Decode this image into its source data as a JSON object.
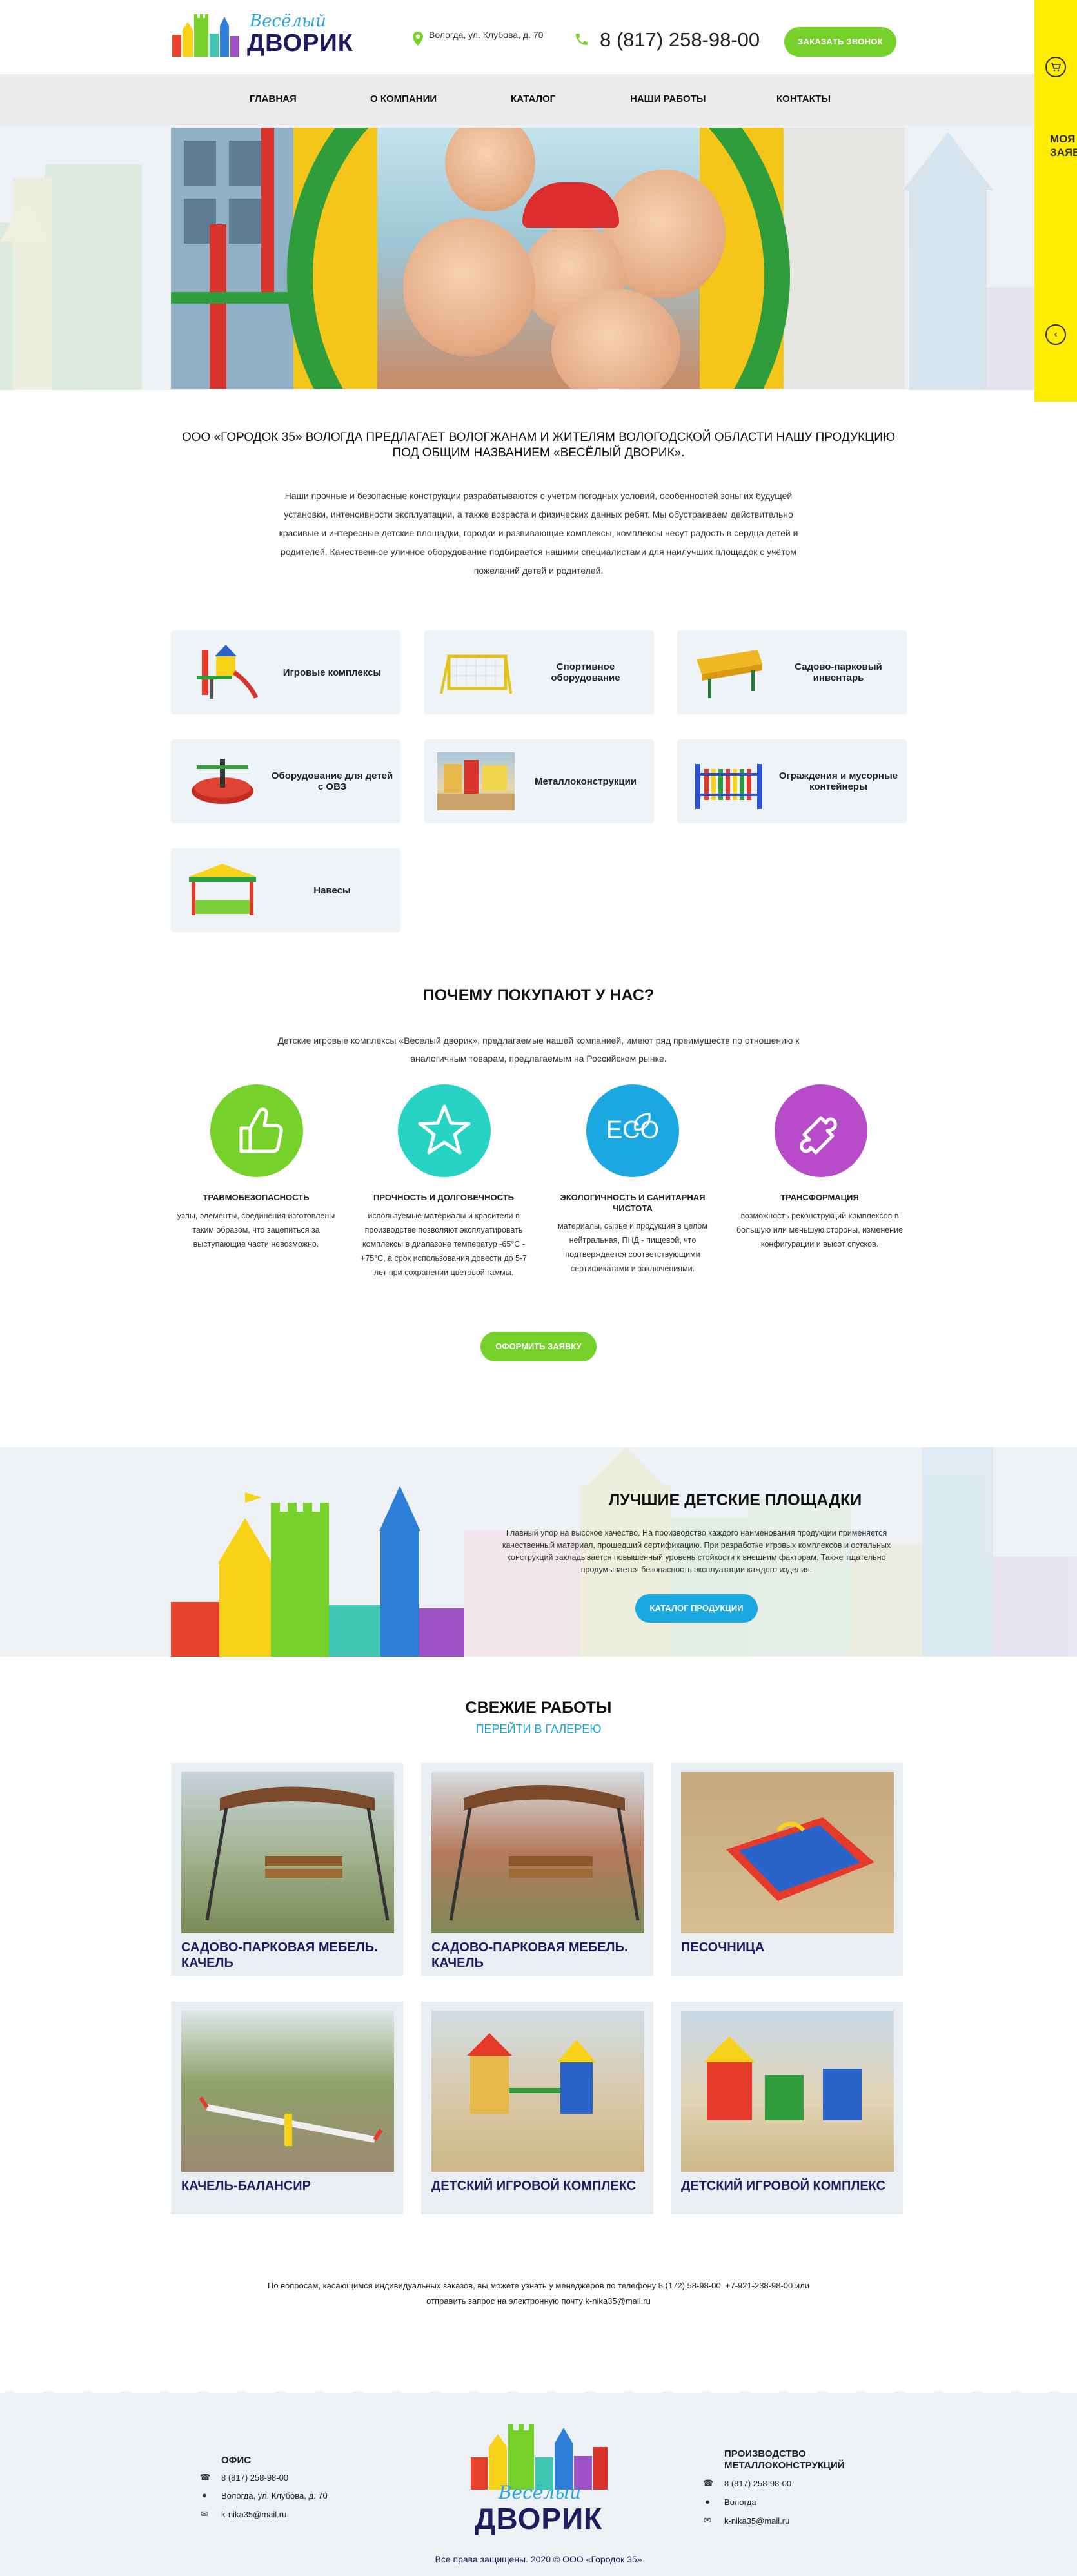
{
  "header": {
    "address": "Вологда, ул. Клубова, д. 70",
    "phone": "8 (817) 258-98-00",
    "call_button": "ЗАКАЗАТЬ ЗВОНОК",
    "logo_small": "Весёлый",
    "logo_big": "ДВОРИК"
  },
  "nav": [
    "ГЛАВНАЯ",
    "О КОМПАНИИ",
    "КАТАЛОГ",
    "НАШИ РАБОТЫ",
    "КОНТАКТЫ"
  ],
  "side_panel": {
    "label": "МОЯ ЗАЯВКА",
    "cart_icon": "cart-icon",
    "arrow_icon": "chevron-left-icon"
  },
  "intro": {
    "title": "ООО «ГОРОДОК 35» ВОЛОГДА ПРЕДЛАГАЕТ ВОЛОГЖАНАМ И ЖИТЕЛЯМ ВОЛОГОДСКОЙ ОБЛАСТИ НАШУ ПРОДУКЦИЮ ПОД ОБЩИМ НАЗВАНИЕМ «ВЕСЁЛЫЙ ДВОРИК».",
    "text": "Наши прочные и безопасные конструкции разрабатываются с учетом погодных условий, особенностей зоны их будущей установки, интенсивности эксплуатации, а также возраста и физических данных ребят. Мы обустраиваем действительно красивые и интересные детские площадки, городки и развивающие комплексы, комплексы несут радость в сердца детей и родителей. Качественное уличное оборудование подбирается нашими специалистами для наилучших площадок с учётом пожеланий детей и родителей."
  },
  "categories": [
    {
      "label": "Игровые комплексы"
    },
    {
      "label": "Спортивное оборудование"
    },
    {
      "label": "Садово-парковый инвентарь"
    },
    {
      "label": "Оборудование для детей с ОВЗ"
    },
    {
      "label": "Металлоконструкции"
    },
    {
      "label": "Ограждения и мусорные контейнеры"
    },
    {
      "label": "Навесы"
    }
  ],
  "why": {
    "title": "ПОЧЕМУ ПОКУПАЮТ У НАС?",
    "subtitle": "Детские игровые комплексы «Веселый дворик», предлагаемые нашей компанией, имеют ряд преимуществ по отношению к аналогичным товарам, предлагаемым на Российском рынке.",
    "features": [
      {
        "title": "ТРАВМОБЕЗОПАСНОСТЬ",
        "text": "узлы, элементы, соединения изготовлены таким образом, что зацепиться за выступающие части невозможно.",
        "icon": "thumbs-up-icon",
        "color": "#76d12a"
      },
      {
        "title": "ПРОЧНОСТЬ И ДОЛГОВЕЧНОСТЬ",
        "text": "используемые материалы и красители в производстве позволяют эксплуатировать комплексы в диапазоне температур -65°С - +75°С, а срок использования довести до 5-7 лет при сохранении цветовой гаммы.",
        "icon": "star-icon",
        "color": "#27d4c4"
      },
      {
        "title": "ЭКОЛОГИЧНОСТЬ И САНИТАРНАЯ ЧИСТОТА",
        "text": "материалы, сырье и продукция в целом нейтральная, ПНД - пищевой, что подтверждается соответствующими сертификатами и заключениями.",
        "icon": "eco-icon",
        "color": "#1ba7df"
      },
      {
        "title": "ТРАНСФОРМАЦИЯ",
        "text": "возможность реконструкций комплексов в большую или меньшую стороны, изменение конфигурации и высот спусков.",
        "icon": "puzzle-icon",
        "color": "#b84bc9"
      }
    ],
    "button": "ОФОРМИТЬ ЗАЯВКУ",
    "eco_label": "ECO"
  },
  "best": {
    "title": "ЛУЧШИЕ ДЕТСКИЕ ПЛОЩАДКИ",
    "text": "Главный упор на высокое качество. На производство каждого наименования продукции применяется качественный материал, прошедший сертификацию. При разработке игровых комплексов и остальных конструкций закладывается повышенный уровень стойкости к внешним факторам. Также тщательно продумывается безопасность эксплуатации каждого изделия.",
    "button": "КАТАЛОГ ПРОДУКЦИИ"
  },
  "works": {
    "title": "СВЕЖИЕ РАБОТЫ",
    "link": "ПЕРЕЙТИ В ГАЛЕРЕЮ",
    "items": [
      {
        "title": "САДОВО-ПАРКОВАЯ МЕБЕЛЬ. КАЧЕЛЬ"
      },
      {
        "title": "САДОВО-ПАРКОВАЯ МЕБЕЛЬ. КАЧЕЛЬ"
      },
      {
        "title": "ПЕСОЧНИЦА"
      },
      {
        "title": "КАЧЕЛЬ-БАЛАНСИР"
      },
      {
        "title": "ДЕТСКИЙ ИГРОВОЙ КОМПЛЕКС"
      },
      {
        "title": "ДЕТСКИЙ ИГРОВОЙ КОМПЛЕКС"
      }
    ]
  },
  "contact_note": "По вопросам, касающимся индивидуальных заказов, вы можете узнать у менеджеров по телефону 8 (172) 58-98-00, +7-921-238-98-00 или отправить запрос на электронную почту k-nika35@mail.ru",
  "footer": {
    "office_title": "ОФИС",
    "office": {
      "phone": "8 (817) 258-98-00",
      "address": "Вологда, ул. Клубова, д. 70",
      "email": "k-nika35@mail.ru"
    },
    "production_title": "ПРОИЗВОДСТВО МЕТАЛЛОКОНСТРУКЦИЙ",
    "production": {
      "phone": "8 (817) 258-98-00",
      "address": "Вологда",
      "email": "k-nika35@mail.ru"
    },
    "copyright": "Все права защищены. 2020 © ООО «Городок 35»"
  },
  "colors": {
    "green": "#76d12a",
    "yellow": "#ffec00",
    "blue": "#1ba7df",
    "navy": "#1c1c5e"
  }
}
